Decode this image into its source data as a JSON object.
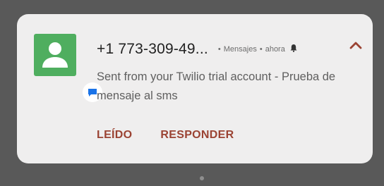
{
  "notification": {
    "sender": "+1 773-309-49...",
    "app_name": "Mensajes",
    "separator": "•",
    "time": "ahora",
    "message": "Sent from your Twilio trial account - Prueba de mensaje al sms",
    "actions": [
      "LEÍDO",
      "RESPONDER"
    ]
  },
  "colors": {
    "avatar_bg": "#4fae5f",
    "action_text": "#9b4333",
    "badge_icon": "#1a73e8",
    "background": "#595959"
  },
  "icons": {
    "avatar": "person-icon",
    "badge": "message-badge-icon",
    "bell": "bell-icon",
    "collapse": "chevron-up-icon"
  }
}
